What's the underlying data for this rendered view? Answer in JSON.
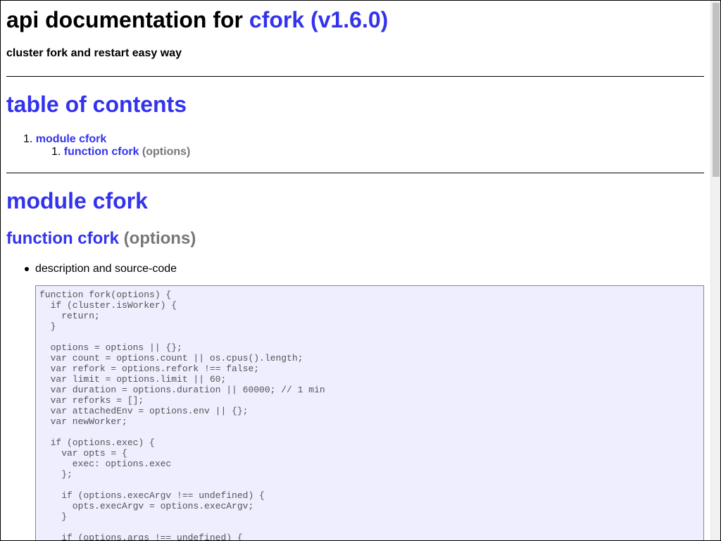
{
  "header": {
    "title_prefix": "api documentation for",
    "title_link": "cfork (v1.6.0)",
    "subtitle": "cluster fork and restart easy way"
  },
  "toc": {
    "heading": "table of contents",
    "items": [
      {
        "number": "1.",
        "label": "module cfork"
      },
      {
        "number": "1.",
        "label": "function cfork",
        "args": "(options)"
      }
    ]
  },
  "module": {
    "heading": "module cfork",
    "function_name": "function cfork",
    "function_args": "(options)",
    "bullet": "description and source-code",
    "code": "function fork(options) {\n  if (cluster.isWorker) {\n    return;\n  }\n\n  options = options || {};\n  var count = options.count || os.cpus().length;\n  var refork = options.refork !== false;\n  var limit = options.limit || 60;\n  var duration = options.duration || 60000; // 1 min\n  var reforks = [];\n  var attachedEnv = options.env || {};\n  var newWorker;\n\n  if (options.exec) {\n    var opts = {\n      exec: options.exec\n    };\n\n    if (options.execArgv !== undefined) {\n      opts.execArgv = options.execArgv;\n    }\n\n    if (options.args !== undefined) {\n      opts.args = options.args;\n    }"
  }
}
